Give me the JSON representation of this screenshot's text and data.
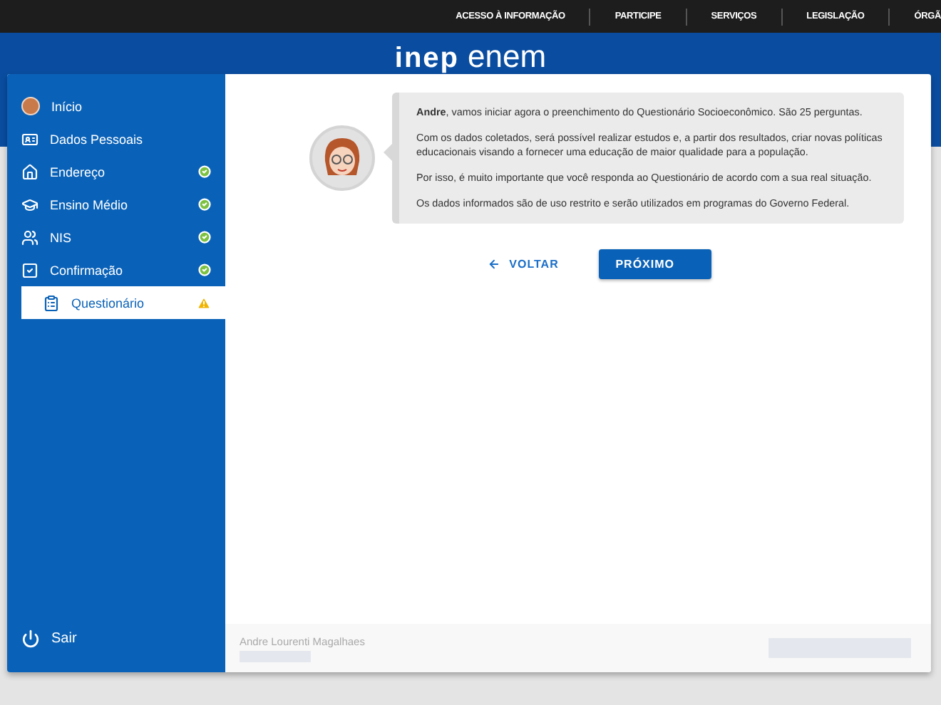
{
  "top_nav": {
    "links": [
      "ACESSO À INFORMAÇÃO",
      "PARTICIPE",
      "SERVIÇOS",
      "LEGISLAÇÃO",
      "ÓRGÃ"
    ]
  },
  "logo": {
    "brand": "inep",
    "product": "enem"
  },
  "sidebar": {
    "items": [
      {
        "label": "Início",
        "complete": false,
        "warning": false,
        "selected": false
      },
      {
        "label": "Dados Pessoais",
        "complete": false,
        "warning": false,
        "selected": false
      },
      {
        "label": "Endereço",
        "complete": true,
        "warning": false,
        "selected": false
      },
      {
        "label": "Ensino Médio",
        "complete": true,
        "warning": false,
        "selected": false
      },
      {
        "label": "NIS",
        "complete": true,
        "warning": false,
        "selected": false
      },
      {
        "label": "Confirmação",
        "complete": true,
        "warning": false,
        "selected": false
      },
      {
        "label": "Questionário",
        "complete": false,
        "warning": true,
        "selected": true
      }
    ],
    "logout": "Sair"
  },
  "message": {
    "paragraphs": [
      "**Andre**, vamos iniciar agora o preenchimento do Questionário Socioeconômico. São 25 perguntas.",
      "Com os dados coletados, será possível realizar estudos e, a partir dos resultados, criar novas políticas educacionais visando a fornecer uma educação de maior qualidade para a população.",
      "Por isso, é muito importante que você responda ao Questionário de acordo com a sua real situação.",
      "Os dados informados são de uso restrito e serão utilizados em programas do Governo Federal."
    ]
  },
  "buttons": {
    "back": "VOLTAR",
    "next": "PRÓXIMO"
  },
  "footer": {
    "user_name": "Andre Lourenti Magalhaes"
  }
}
